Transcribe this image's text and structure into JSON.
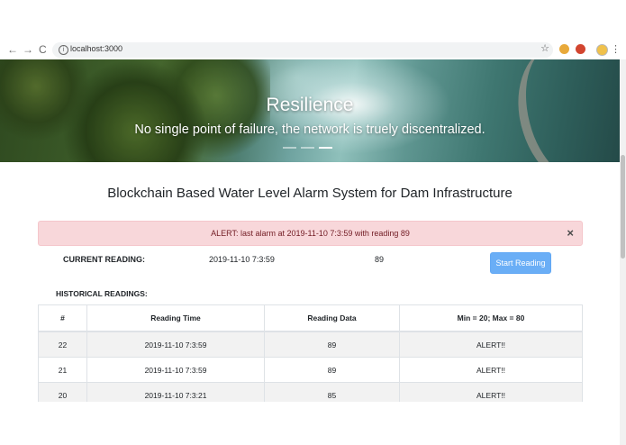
{
  "browser": {
    "url": "localhost:3000",
    "back_icon": "←",
    "forward_icon": "→",
    "reload_icon": "C",
    "info_icon": "i",
    "star_icon": "☆",
    "menu_icon": "⋮"
  },
  "hero": {
    "title": "Resilience",
    "subtitle": "No single point of failure, the network is truely discentralized.",
    "slides": 3,
    "active_slide": 3
  },
  "page": {
    "title": "Blockchain Based Water Level Alarm System for Dam Infrastructure"
  },
  "alert": {
    "text": "ALERT: last alarm at 2019-11-10 7:3:59 with reading 89",
    "close_label": "×"
  },
  "current": {
    "label": "CURRENT READING:",
    "time": "2019-11-10 7:3:59",
    "value": "89",
    "start_button_label": "Start Reading"
  },
  "history": {
    "label": "HISTORICAL READINGS:",
    "columns": [
      "#",
      "Reading Time",
      "Reading Data",
      "Min = 20; Max = 80"
    ],
    "rows": [
      {
        "id": "22",
        "time": "2019-11-10 7:3:59",
        "data": "89",
        "status": "ALERT!!"
      },
      {
        "id": "21",
        "time": "2019-11-10 7:3:59",
        "data": "89",
        "status": "ALERT!!"
      },
      {
        "id": "20",
        "time": "2019-11-10 7:3:21",
        "data": "85",
        "status": "ALERT!!"
      }
    ]
  },
  "colors": {
    "alert_bg": "#f8d7da",
    "alert_text": "#721c24",
    "button": "#6aaef6"
  }
}
